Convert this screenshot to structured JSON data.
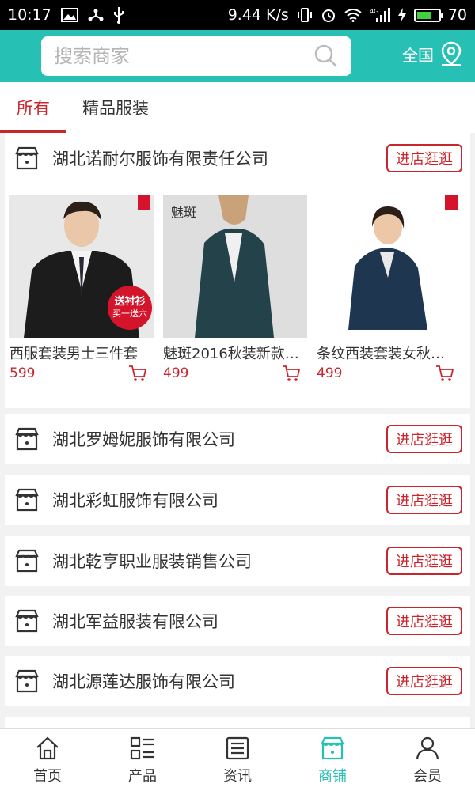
{
  "status_bar": {
    "time": "10:17",
    "network_speed": "9.44 K/s",
    "signal_label": "4G",
    "battery_level": "70",
    "battery_fraction": 0.7
  },
  "search": {
    "placeholder": "搜索商家"
  },
  "region": {
    "label": "全国"
  },
  "tabs": [
    {
      "label": "所有",
      "active": true
    },
    {
      "label": "精品服装",
      "active": false
    }
  ],
  "featured_shop": {
    "name": "湖北诺耐尔服饰有限责任公司",
    "visit_label": "进店逛逛",
    "products": [
      {
        "title": "西服套装男士三件套",
        "price": "599",
        "badge_line1": "送衬衫",
        "badge_line2": "买一送六"
      },
      {
        "title": "魅斑2016秋装新款…",
        "price": "499",
        "brand": "魅斑"
      },
      {
        "title": "条纹西装套装女秋…",
        "price": "499"
      }
    ]
  },
  "shops": [
    {
      "name": "湖北罗姆妮服饰有限公司",
      "visit_label": "进店逛逛"
    },
    {
      "name": "湖北彩虹服饰有限公司",
      "visit_label": "进店逛逛"
    },
    {
      "name": "湖北乾亨职业服装销售公司",
      "visit_label": "进店逛逛"
    },
    {
      "name": "湖北军益服装有限公司",
      "visit_label": "进店逛逛"
    },
    {
      "name": "湖北源莲达服饰有限公司",
      "visit_label": "进店逛逛"
    }
  ],
  "bottom_nav": [
    {
      "label": "首页",
      "icon": "home-icon",
      "active": false
    },
    {
      "label": "产品",
      "icon": "grid-list-icon",
      "active": false
    },
    {
      "label": "资讯",
      "icon": "news-icon",
      "active": false
    },
    {
      "label": "商铺",
      "icon": "shop-icon",
      "active": true
    },
    {
      "label": "会员",
      "icon": "user-icon",
      "active": false
    }
  ],
  "colors": {
    "brand": "#26c1b4",
    "accent": "#c9252c"
  }
}
